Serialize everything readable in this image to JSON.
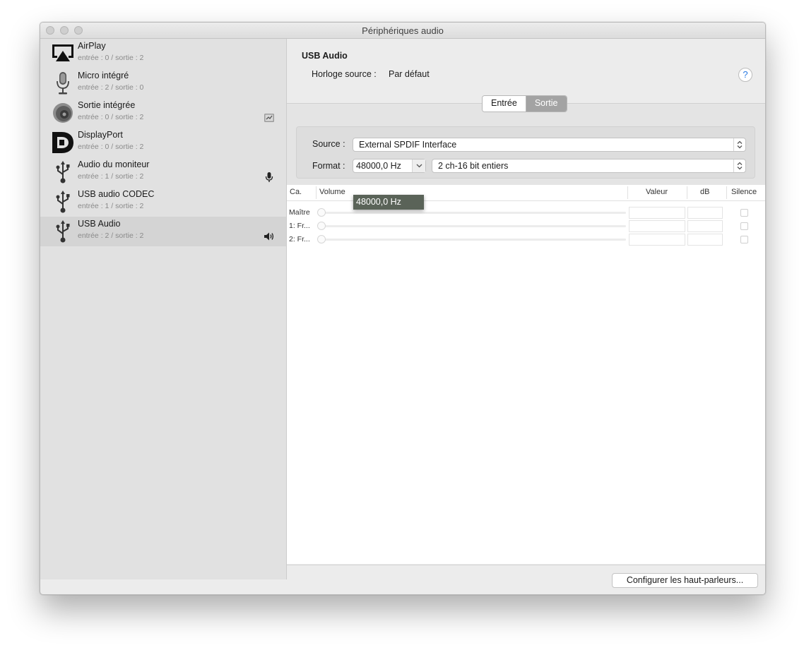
{
  "window": {
    "title": "Périphériques audio"
  },
  "devices": [
    {
      "name": "AirPlay",
      "sub": "entrée : 0 / sortie : 2",
      "icon": "airplay-icon"
    },
    {
      "name": "Micro intégré",
      "sub": "entrée : 2 / sortie : 0",
      "icon": "microphone-icon"
    },
    {
      "name": "Sortie intégrée",
      "sub": "entrée : 0 / sortie : 2",
      "icon": "speaker-icon",
      "badge": "system-output-icon"
    },
    {
      "name": "DisplayPort",
      "sub": "entrée : 0 / sortie : 2",
      "icon": "displayport-icon"
    },
    {
      "name": "Audio du moniteur",
      "sub": "entrée : 1 / sortie : 2",
      "icon": "usb-icon",
      "badge": "microphone-input-icon"
    },
    {
      "name": "USB audio CODEC",
      "sub": "entrée : 1 / sortie : 2",
      "icon": "usb-icon"
    },
    {
      "name": "USB Audio",
      "sub": "entrée : 2 / sortie : 2",
      "icon": "usb-icon",
      "badge": "speaker-output-icon",
      "selected": true
    }
  ],
  "toolbar": {
    "add": "+",
    "remove": "—"
  },
  "detail": {
    "title": "USB Audio",
    "clock_label": "Horloge source :",
    "clock_value": "Par défaut",
    "help": "?",
    "tabs": {
      "input": "Entrée",
      "output": "Sortie"
    },
    "source_label": "Source :",
    "source_value": "External SPDIF Interface",
    "format_label": "Format :",
    "format_rate": "48000,0 Hz",
    "format_bits": "2 ch-16 bit entiers",
    "dropdown_option": "48000,0 Hz"
  },
  "table": {
    "headers": {
      "channel": "Ca.",
      "volume": "Volume",
      "value": "Valeur",
      "db": "dB",
      "mute": "Silence"
    },
    "rows": [
      {
        "label": "Maître"
      },
      {
        "label": "1: Fr..."
      },
      {
        "label": "2: Fr..."
      }
    ]
  },
  "footer": {
    "configure": "Configurer les haut-parleurs..."
  },
  "colors": {
    "selected_row": "#d4d4d4",
    "segment_active": "#a3a3a3",
    "dropdown_highlight": "#5a6358"
  }
}
